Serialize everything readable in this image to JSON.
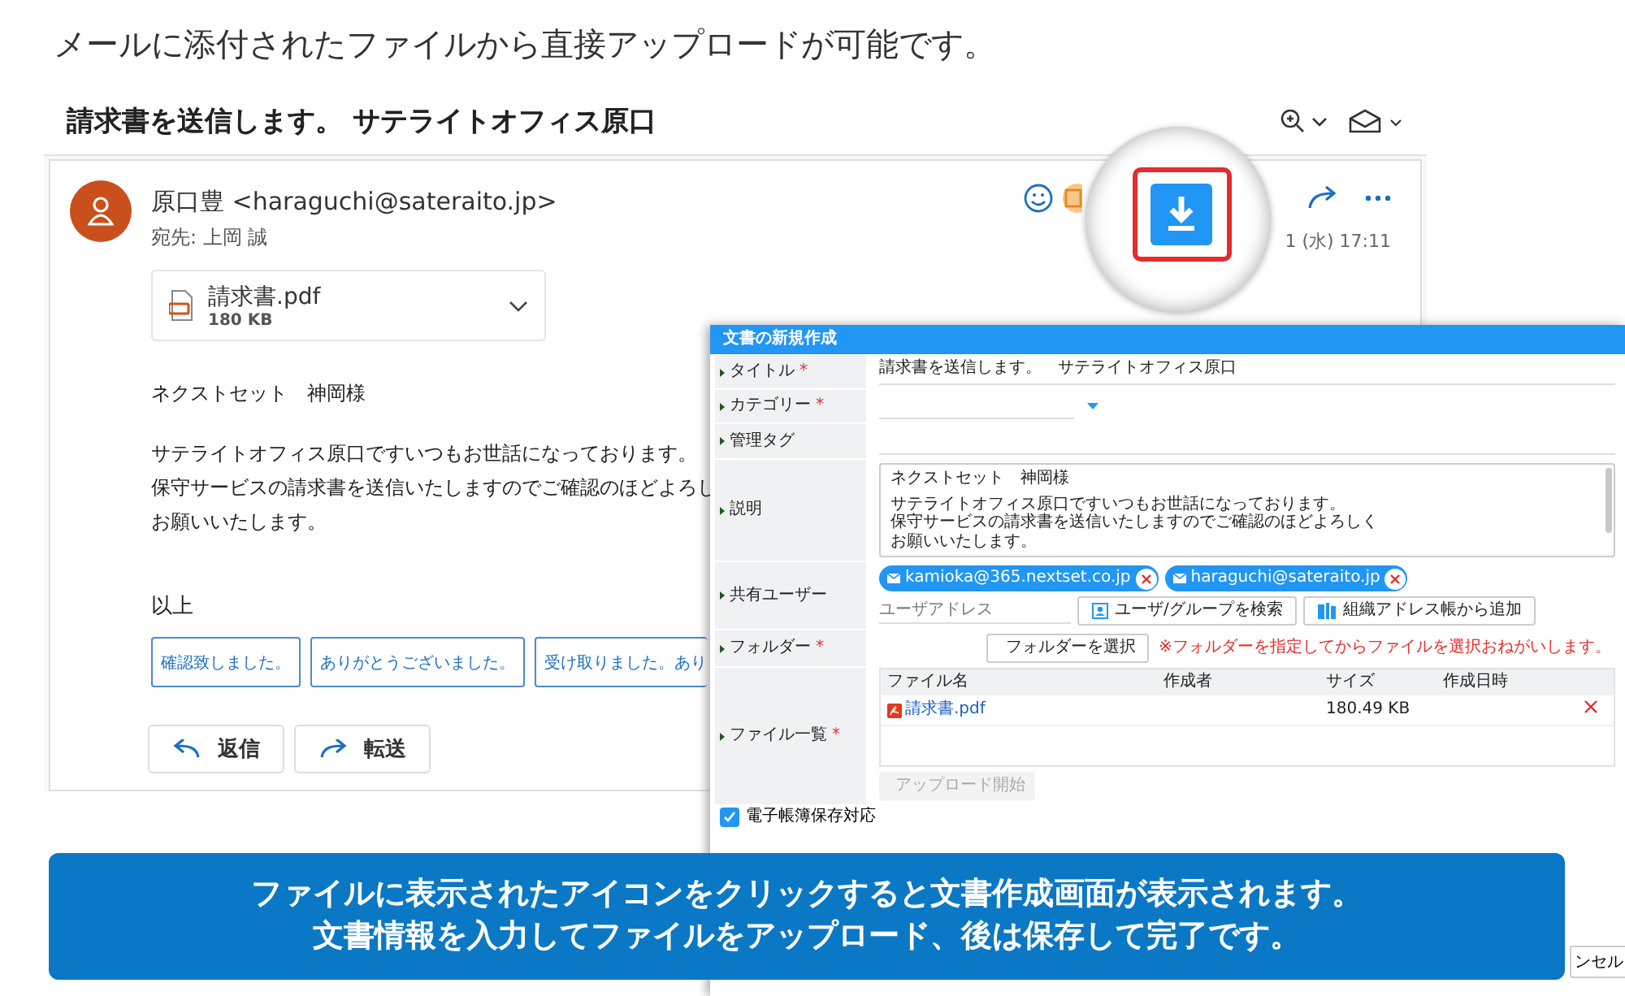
{
  "caption": "メールに添付されたファイルから直接アップロードが可能です。",
  "email": {
    "subject": "請求書を送信します。 サテライトオフィス原口",
    "sender": "原口豊 <haraguchi@sateraito.jp>",
    "recipient": "宛先: 上岡 誠",
    "date": "1 (水) 17:11",
    "attachment": {
      "name": "請求書.pdf",
      "size": "180 KB"
    },
    "greeting": "ネクストセット　神岡様",
    "body": [
      "サテライトオフィス原口ですいつもお世話になっております。",
      "保守サービスの請求書を送信いたしますのでご確認のほどよろし",
      "お願いいたします。"
    ],
    "closing": "以上",
    "quick_replies": [
      "確認致しました。",
      "ありがとうございました。",
      "受け取りました。あり"
    ],
    "actions": [
      {
        "kind": "reply",
        "label": "返信"
      },
      {
        "kind": "forward",
        "label": "転送"
      }
    ]
  },
  "dialog": {
    "title": "文書の新規作成",
    "rows": [
      {
        "kind": "text",
        "label": "タイトル",
        "mark": "*",
        "value": "請求書を送信します。　サテライトオフィス原口"
      },
      {
        "kind": "select",
        "label": "カテゴリー",
        "mark": "*"
      },
      {
        "kind": "tags",
        "label": "管理タグ"
      },
      {
        "kind": "textarea",
        "label": "説明",
        "paragraphs": [
          [
            "ネクストセット　神岡様"
          ],
          [
            "サテライトオフィス原口ですいつもお世話になっております。",
            "保守サービスの請求書を送信いたしますのでご確認のほどよろしく",
            "お願いいたします。"
          ]
        ]
      },
      {
        "kind": "users",
        "label": "共有ユーザー",
        "chips": [
          "kamioka@365.nextset.co.jp",
          "haraguchi@sateraito.jp"
        ],
        "placeholder": "ユーザアドレス",
        "buttons": [
          {
            "kind": "search",
            "label": "ユーザ/グループを検索"
          },
          {
            "kind": "book",
            "label": "組織アドレス帳から追加"
          }
        ]
      },
      {
        "kind": "folder",
        "label": "フォルダー",
        "mark": "*",
        "button": "フォルダーを選択",
        "note": "※フォルダーを指定してからファイルを選択おねがいします。"
      },
      {
        "kind": "files",
        "label": "ファイル一覧",
        "mark": "*",
        "columns": [
          "ファイル名",
          "作成者",
          "サイズ",
          "作成日時"
        ],
        "files": [
          {
            "name": "請求書.pdf",
            "size": "180.49 KB"
          }
        ],
        "upload_button": {
          "label": "アップロード開始",
          "disabled": true
        }
      }
    ],
    "checkbox": {
      "label": "電子帳簿保存対応",
      "checked": true
    },
    "cancel_button": "ンセル"
  },
  "banner": [
    "ファイルに表示されたアイコンをクリックすると文書作成画面が表示されます。",
    "文書情報を入力してファイルをアップロード、後は保存して完了です。"
  ]
}
